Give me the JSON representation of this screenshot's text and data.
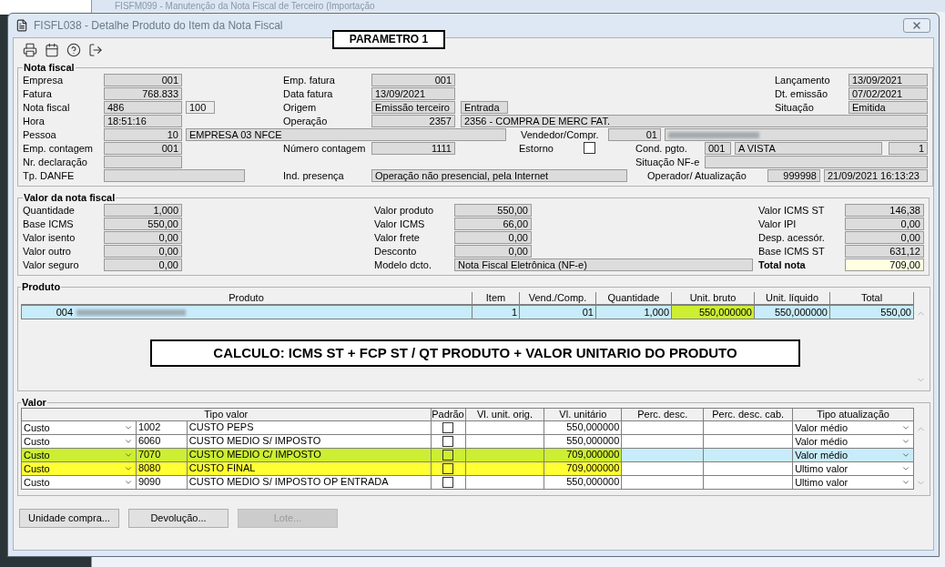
{
  "background_window": {
    "title": "FISFM099 - Manutenção da Nota Fiscal de Terceiro (Importação"
  },
  "window": {
    "title": "FISFL038 - Detalhe Produto do Item da Nota Fiscal"
  },
  "toolbar": [
    {
      "kind": "print"
    },
    {
      "kind": "calendar"
    },
    {
      "kind": "help"
    },
    {
      "kind": "exit"
    }
  ],
  "annotation_top": "PARAMETRO 1",
  "nota_fiscal": {
    "title": "Nota fiscal",
    "empresa": {
      "label": "Empresa",
      "value": "001"
    },
    "fatura": {
      "label": "Fatura",
      "value": "768.833"
    },
    "nota": {
      "label": "Nota fiscal",
      "value": "486",
      "serie": "100"
    },
    "hora": {
      "label": "Hora",
      "value": "18:51:16"
    },
    "pessoa": {
      "label": "Pessoa",
      "value": "10",
      "name": "EMPRESA 03 NFCE"
    },
    "emp_contagem": {
      "label": "Emp. contagem",
      "value": "001"
    },
    "nr_declaracao": {
      "label": "Nr. declaração"
    },
    "tp_danfe": {
      "label": "Tp. DANFE"
    },
    "emp_fatura": {
      "label": "Emp. fatura",
      "value": "001"
    },
    "data_fatura": {
      "label": "Data fatura",
      "value": "13/09/2021"
    },
    "origem": {
      "label": "Origem",
      "value": "Emissão terceiro",
      "tipo": "Entrada"
    },
    "operacao": {
      "label": "Operação",
      "value": "2357",
      "description": "2356 - COMPRA DE MERC FAT."
    },
    "numero_contagem": {
      "label": "Número contagem",
      "value": "1111"
    },
    "ind_presenca": {
      "label": "Ind. presença",
      "value": "Operação não presencial, pela Internet"
    },
    "vendedor": {
      "label": "Vendedor/Compr.",
      "value": "01"
    },
    "estorno": {
      "label": "Estorno",
      "checked": false
    },
    "lancamento": {
      "label": "Lançamento",
      "value": "13/09/2021"
    },
    "dt_emissao": {
      "label": "Dt. emissão",
      "value": "07/02/2021"
    },
    "situacao": {
      "label": "Situação",
      "value": "Emitida"
    },
    "cond_pgto": {
      "label": "Cond. pgto.",
      "value": "001",
      "description": "A VISTA",
      "parcelas": "1"
    },
    "situacao_nfe": {
      "label": "Situação NF-e"
    },
    "operador": {
      "label": "Operador/ Atualização",
      "value": "999998",
      "date": "21/09/2021 16:13:23"
    }
  },
  "valor_nf": {
    "title": "Valor da nota fiscal",
    "left": [
      {
        "label": "Quantidade",
        "value": "1,000"
      },
      {
        "label": "Base ICMS",
        "value": "550,00"
      },
      {
        "label": "Valor isento",
        "value": "0,00"
      },
      {
        "label": "Valor outro",
        "value": "0,00"
      },
      {
        "label": "Valor seguro",
        "value": "0,00"
      }
    ],
    "middle": [
      {
        "label": "Valor produto",
        "value": "550,00",
        "kind": "number"
      },
      {
        "label": "Valor ICMS",
        "value": "66,00",
        "kind": "number"
      },
      {
        "label": "Valor frete",
        "value": "0,00",
        "kind": "number"
      },
      {
        "label": "Desconto",
        "value": "0,00",
        "kind": "number"
      },
      {
        "label": "Modelo dcto.",
        "value": "Nota Fiscal Eletrônica (NF-e)",
        "kind": "wide"
      }
    ],
    "right": [
      {
        "label": "Valor ICMS ST",
        "value": "146,38",
        "kind": "number"
      },
      {
        "label": "Valor IPI",
        "value": "0,00",
        "kind": "number"
      },
      {
        "label": "Desp. acessór.",
        "value": "0,00",
        "kind": "number"
      },
      {
        "label": "Base ICMS ST",
        "value": "631,12",
        "kind": "number"
      },
      {
        "label": "Total nota",
        "value": "709,00",
        "kind": "total"
      }
    ]
  },
  "produto": {
    "title": "Produto",
    "columns": [
      "Produto",
      "Item",
      "Vend./Comp.",
      "Quantidade",
      "Unit. bruto",
      "Unit. líquido",
      "Total"
    ],
    "rows": [
      {
        "selected": true,
        "cells": [
          {
            "text": "004",
            "highlight": false
          },
          {
            "text": "1",
            "highlight": false
          },
          {
            "text": "01",
            "highlight": false
          },
          {
            "text": "1,000",
            "highlight": false
          },
          {
            "text": "550,000000",
            "highlight": true
          },
          {
            "text": "550,000000",
            "highlight": false
          },
          {
            "text": "550,00",
            "highlight": false
          }
        ]
      }
    ],
    "annotation": "CALCULO: ICMS ST + FCP ST / QT PRODUTO + VALOR UNITARIO DO PRODUTO"
  },
  "valor": {
    "title": "Valor",
    "columns": [
      "Tipo valor",
      "Padrão",
      "Vl. unit. orig.",
      "Vl. unitário",
      "Perc. desc.",
      "Perc. desc. cab.",
      "Tipo atualização"
    ],
    "rows": [
      {
        "tipo": "Custo",
        "code": "1002",
        "description": "CUSTO PEPS",
        "padrao": false,
        "vl_unitario": "550,000000",
        "tipo_atualizacao": "Valor médio",
        "selected": false,
        "highlight": false
      },
      {
        "tipo": "Custo",
        "code": "6060",
        "description": "CUSTO MEDIO S/ IMPOSTO",
        "padrao": false,
        "vl_unitario": "550,000000",
        "tipo_atualizacao": "Valor médio",
        "selected": false,
        "highlight": false
      },
      {
        "tipo": "Custo",
        "code": "7070",
        "description": "CUSTO MEDIO C/ IMPOSTO",
        "padrao": false,
        "vl_unitario": "709,000000",
        "tipo_atualizacao": "Valor médio",
        "selected": true,
        "highlight": true
      },
      {
        "tipo": "Custo",
        "code": "8080",
        "description": "CUSTO FINAL",
        "padrao": false,
        "vl_unitario": "709,000000",
        "tipo_atualizacao": "Ultimo valor",
        "selected": false,
        "highlight": true
      },
      {
        "tipo": "Custo",
        "code": "9090",
        "description": "CUSTO MEDIO S/ IMPOSTO OP ENTRADA",
        "padrao": false,
        "vl_unitario": "550,000000",
        "tipo_atualizacao": "Ultimo valor",
        "selected": false,
        "highlight": false
      }
    ]
  },
  "buttons": [
    {
      "label": "Unidade compra...",
      "disabled": false
    },
    {
      "label": "Devolução...",
      "disabled": false
    },
    {
      "label": "Lote...",
      "disabled": true
    }
  ]
}
